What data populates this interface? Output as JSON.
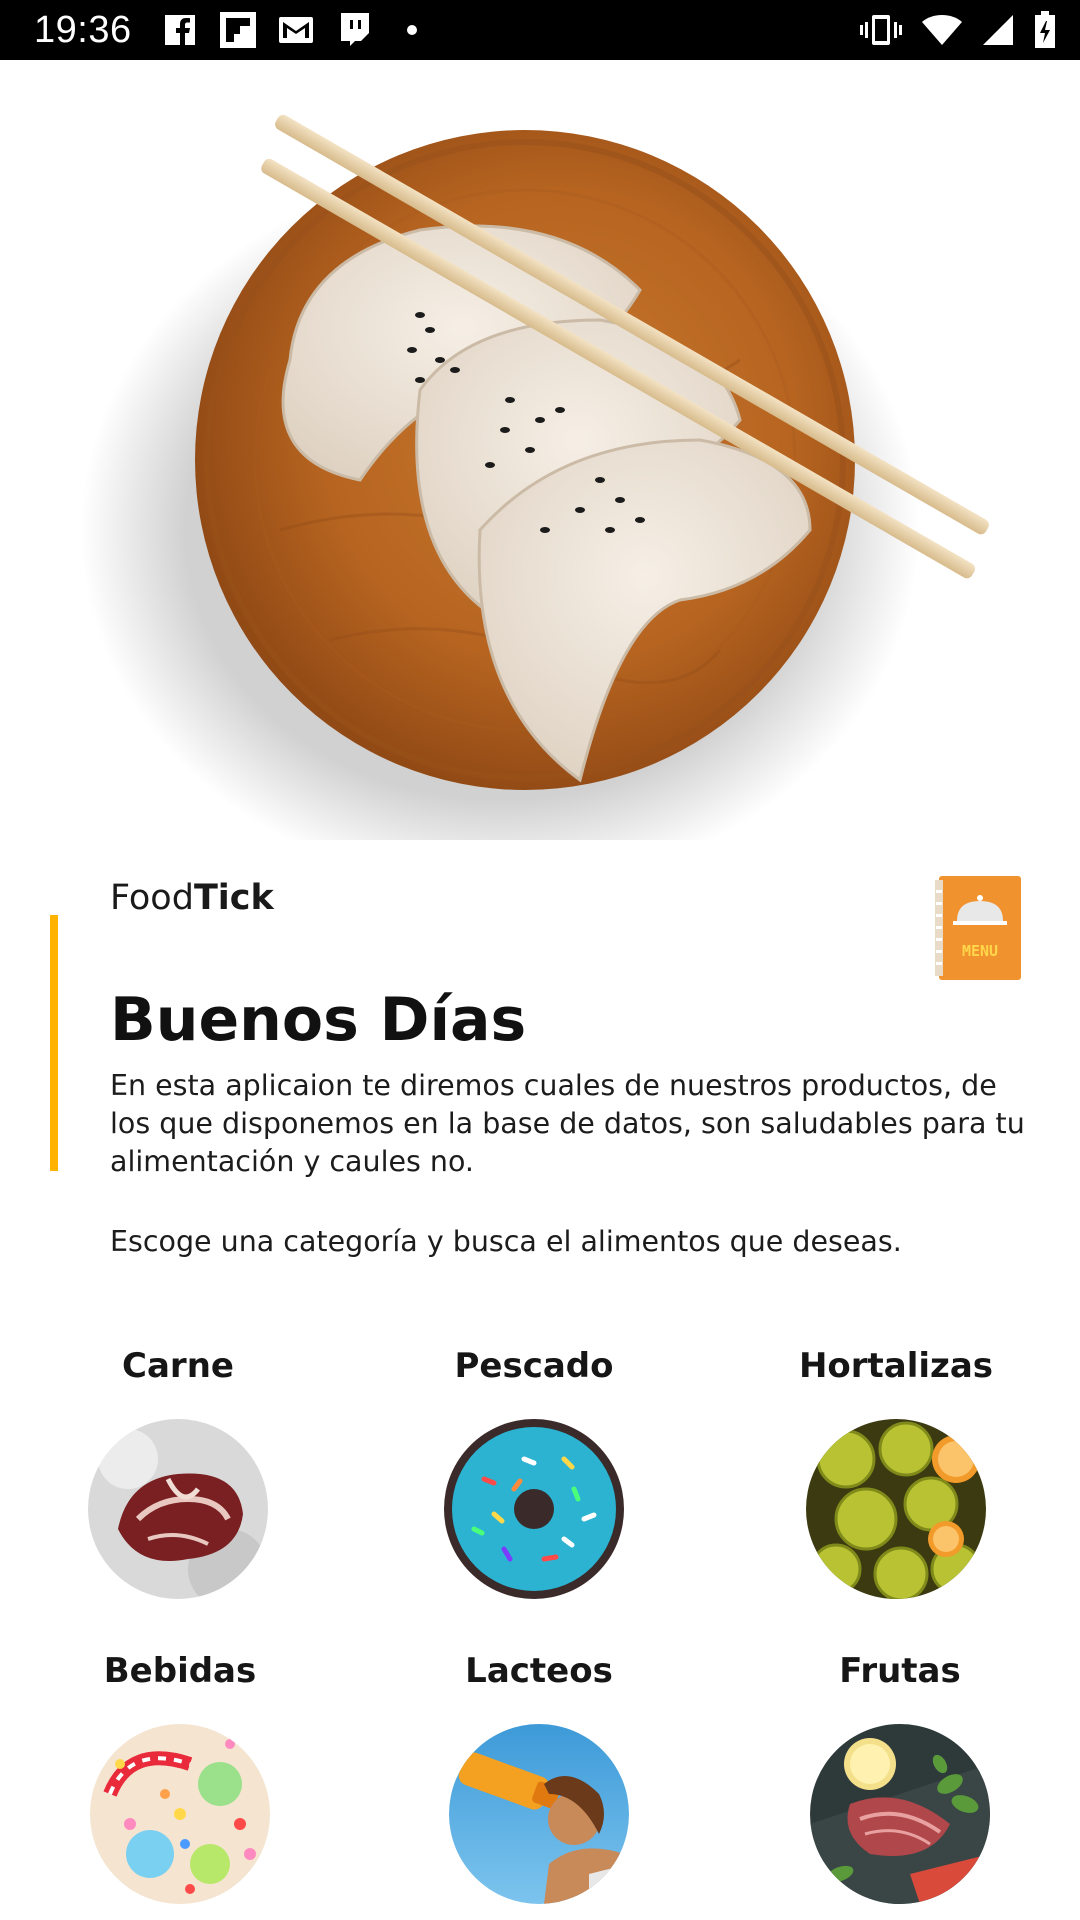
{
  "status_bar": {
    "time": "19:36",
    "notifications": [
      "facebook-icon",
      "flipboard-icon",
      "gmail-icon",
      "twitch-icon",
      "more-dot-icon"
    ],
    "system": [
      "vibrate-icon",
      "wifi-icon",
      "signal-icon",
      "battery-icon"
    ]
  },
  "brand": {
    "prefix": "Food",
    "bold": "Tick"
  },
  "menu_button": {
    "label": "MENU",
    "color": "#f0922e"
  },
  "greeting": "Buenos Días",
  "description": "En esta aplicaion te diremos cuales de nuestros productos, de los que disponemos en la base de datos, son saludables para tu alimentación y caules no.",
  "instruction": "Escoge una categoría y busca el alimentos que deseas.",
  "accent_color": "#ffb300",
  "categories": [
    {
      "label": "Carne"
    },
    {
      "label": "Pescado"
    },
    {
      "label": "Hortalizas"
    },
    {
      "label": "Bebidas"
    },
    {
      "label": "Lacteos"
    },
    {
      "label": "Frutas"
    }
  ]
}
